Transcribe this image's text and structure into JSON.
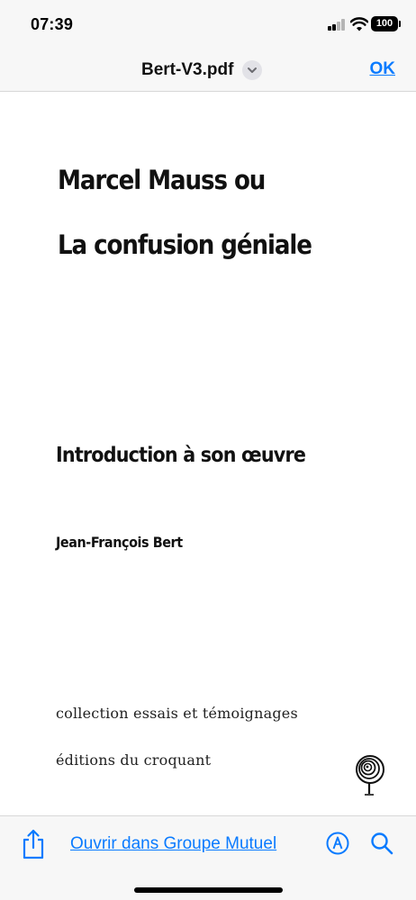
{
  "status_bar": {
    "time": "07:39",
    "battery": "100",
    "icons": [
      "signal-icon",
      "wifi-icon",
      "battery-icon"
    ]
  },
  "nav": {
    "title": "Bert-V3.pdf",
    "title_icon": "chevron-down-icon",
    "done_label": "OK"
  },
  "document": {
    "title_line1": "Marcel Mauss ou",
    "title_line2": "La confusion géniale",
    "subtitle": "Introduction à son œuvre",
    "author": "Jean-François Bert",
    "collection": "collection essais et témoignages",
    "publisher": "éditions du croquant",
    "logo_icon": "tree-logo-icon"
  },
  "toolbar": {
    "share_icon": "share-icon",
    "open_in_label": "Ouvrir dans Groupe Mutuel",
    "markup_icon": "markup-pen-icon",
    "search_icon": "search-icon"
  },
  "colors": {
    "accent": "#0a7bff",
    "bar_background": "#f7f7f7",
    "page_background": "#ffffff"
  }
}
